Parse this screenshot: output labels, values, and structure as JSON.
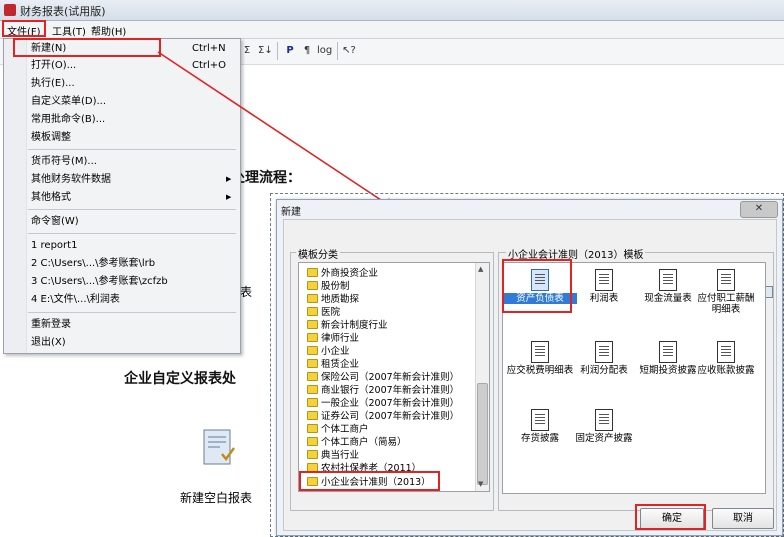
{
  "window": {
    "title": "财务报表(试用版)"
  },
  "menubar": {
    "items": [
      "文件(F)",
      "工具(T)",
      "帮助(H)"
    ]
  },
  "toolbar": {
    "buttons": [
      "Σ",
      "Σ↓",
      "P",
      "¶",
      "log",
      "↖?"
    ]
  },
  "background": {
    "heading_flow": "处理流程：",
    "heading_custom": "企业自定义报表处",
    "fragment_report": "账表",
    "new_blank_report": "新建空白报表"
  },
  "file_menu": {
    "items": [
      {
        "label": "新建(N)",
        "shortcut": "Ctrl+N"
      },
      {
        "label": "打开(O)...",
        "shortcut": "Ctrl+O"
      },
      {
        "label": "执行(E)..."
      },
      {
        "label": "自定义菜单(D)..."
      },
      {
        "label": "常用批命令(B)..."
      },
      {
        "label": "模板调整"
      },
      {
        "label": "货币符号(M)..."
      },
      {
        "label": "其他财务软件数据",
        "submenu": true
      },
      {
        "label": "其他格式",
        "submenu": true
      },
      {
        "label": "命令窗(W)"
      },
      {
        "label": "1 report1"
      },
      {
        "label": "2 C:\\Users\\...\\参考账套\\lrb"
      },
      {
        "label": "3 C:\\Users\\...\\参考账套\\zcfzb"
      },
      {
        "label": "4 E:\\文件\\...\\利润表"
      },
      {
        "label": "重新登录"
      },
      {
        "label": "退出(X)"
      }
    ]
  },
  "dialog": {
    "title": "新建",
    "close_label": "✕",
    "category_group_label": "模板分类",
    "template_group_label": "小企业会计准则（2013）模板",
    "categories": [
      "外商投资企业",
      "股份制",
      "地质勘探",
      "医院",
      "新会计制度行业",
      "律师行业",
      "小企业",
      "租赁企业",
      "保险公司（2007年新会计准则）",
      "商业银行（2007年新会计准则）",
      "一般企业（2007年新会计准则）",
      "证券公司（2007年新会计准则）",
      "个体工商户",
      "个体工商户（简易）",
      "典当行业",
      "农村社保养老（2011）",
      "小企业会计准则（2013）"
    ],
    "templates": [
      "资产负债表",
      "利润表",
      "现金流量表",
      "应付职工薪酬明细表",
      "应交税费明细表",
      "利润分配表",
      "短期投资披露",
      "应收账款披露",
      "存货披露",
      "固定资产披露"
    ],
    "ok_label": "确定",
    "cancel_label": "取消"
  },
  "colors": {
    "annotation_red": "#e02424",
    "selection_blue": "#2f7bd6",
    "folder_yellow": "#f4d23c"
  }
}
